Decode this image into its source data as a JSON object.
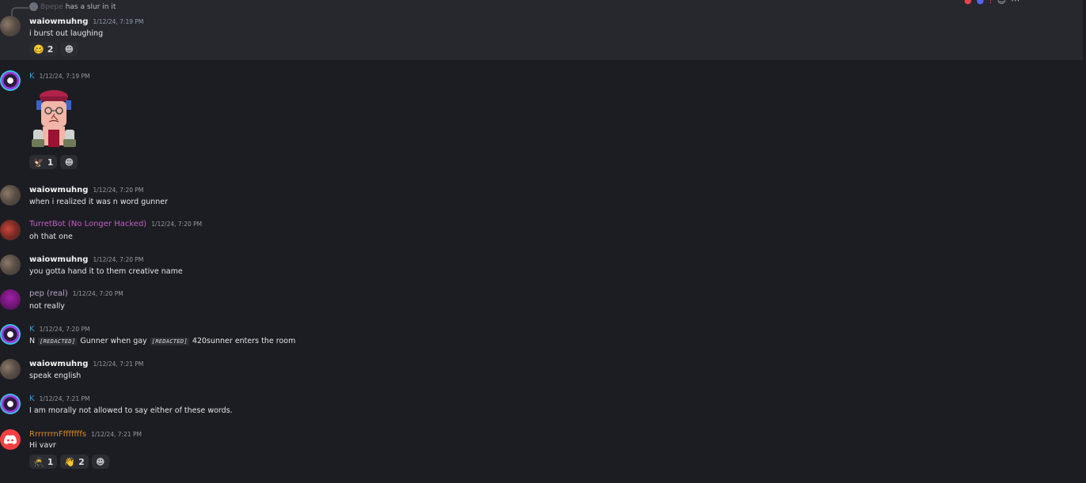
{
  "messages": [
    {
      "reply_preview": {
        "author": "Bpepe",
        "text": "has a slur in it"
      },
      "author": "waiowmuhng",
      "timestamp": "1/12/24, 7:19 PM",
      "content": "i burst out laughing",
      "reactions": [
        {
          "emoji": "🥴",
          "count": "2"
        }
      ]
    },
    {
      "author": "K",
      "timestamp": "1/12/24, 7:19 PM",
      "content": "",
      "reactions": [
        {
          "emoji": "🦅",
          "count": "1"
        }
      ]
    },
    {
      "author": "waiowmuhng",
      "timestamp": "1/12/24, 7:20 PM",
      "content": "when i realized it was n word gunner"
    },
    {
      "author": "TurretBot (No Longer Hacked)",
      "timestamp": "1/12/24, 7:20 PM",
      "content": "oh that one"
    },
    {
      "author": "waiowmuhng",
      "timestamp": "1/12/24, 7:20 PM",
      "content": "you gotta hand it to them creative name"
    },
    {
      "author": "pep (real)",
      "timestamp": "1/12/24, 7:20 PM",
      "content": "not really"
    },
    {
      "author": "K",
      "timestamp": "1/12/24, 7:20 PM",
      "content_parts": [
        "N",
        "[REDACTED]",
        "Gunner when gay",
        "[REDACTED]",
        "420sunner enters the room"
      ]
    },
    {
      "author": "waiowmuhng",
      "timestamp": "1/12/24, 7:21 PM",
      "content": "speak english"
    },
    {
      "author": "K",
      "timestamp": "1/12/24, 7:21 PM",
      "content": "I am morally not allowed to say either of these words."
    },
    {
      "author": "RrrrrrrnFfffffffs",
      "timestamp": "1/12/24, 7:21 PM",
      "content": "Hi vavr",
      "reactions": [
        {
          "emoji": "🥷",
          "count": "1"
        },
        {
          "emoji": "👋",
          "count": "2"
        }
      ]
    }
  ],
  "icons": {
    "add_reaction": "smiley-add-icon",
    "discord_logo": "discord-logo-icon"
  },
  "colors": {
    "background": "#1c1d22",
    "highlight": "#26282e",
    "name_blue": "#3e9bd6",
    "name_pink": "#c25ec4",
    "name_orange": "#d68a2f",
    "discord_red": "#f23f42"
  }
}
